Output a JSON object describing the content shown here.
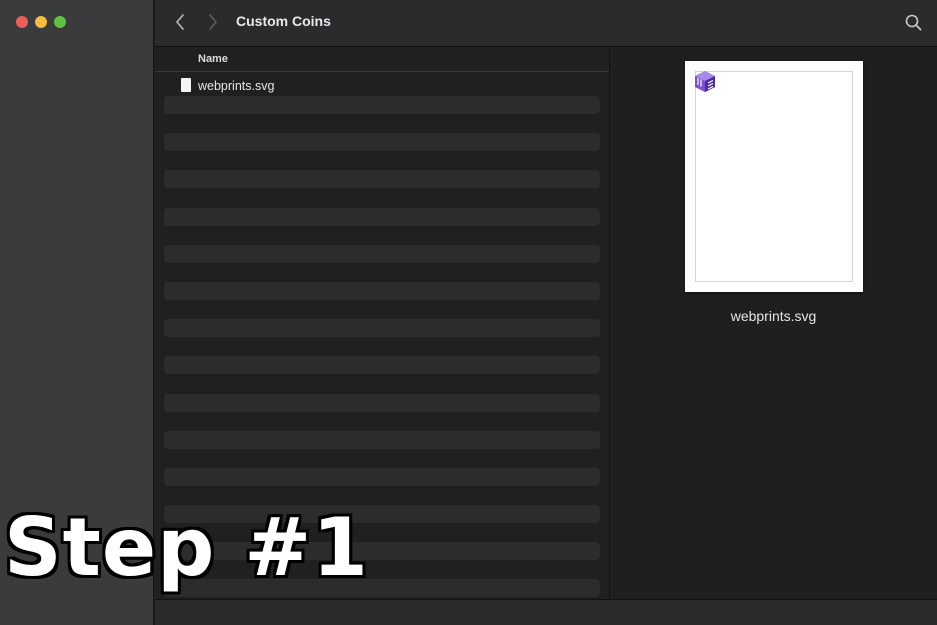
{
  "window": {
    "title": "Custom Coins"
  },
  "list": {
    "column_header": "Name",
    "files": [
      {
        "name": "webprints.svg",
        "icon": "document-icon"
      }
    ]
  },
  "preview": {
    "file_name": "webprints.svg"
  },
  "overlay": {
    "caption": "Step #1"
  },
  "colors": {
    "close": "#ee5d57",
    "minimize": "#f4bd3f",
    "zoom": "#5fc13f",
    "logo_accent": "#6a3fc4"
  }
}
